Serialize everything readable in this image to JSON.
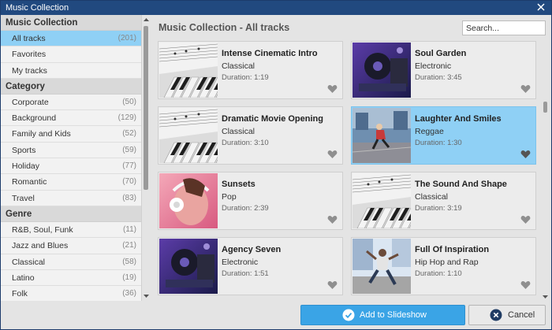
{
  "window": {
    "title": "Music Collection"
  },
  "sidebar": {
    "sections": [
      {
        "header": "Music Collection",
        "items": [
          {
            "label": "All tracks",
            "count": "(201)",
            "selected": true
          },
          {
            "label": "Favorites",
            "count": ""
          },
          {
            "label": "My tracks",
            "count": ""
          }
        ]
      },
      {
        "header": "Category",
        "items": [
          {
            "label": "Corporate",
            "count": "(50)"
          },
          {
            "label": "Background",
            "count": "(129)"
          },
          {
            "label": "Family and Kids",
            "count": "(52)"
          },
          {
            "label": "Sports",
            "count": "(59)"
          },
          {
            "label": "Holiday",
            "count": "(77)"
          },
          {
            "label": "Romantic",
            "count": "(70)"
          },
          {
            "label": "Travel",
            "count": "(83)"
          }
        ]
      },
      {
        "header": "Genre",
        "items": [
          {
            "label": "R&B, Soul, Funk",
            "count": "(11)"
          },
          {
            "label": "Jazz and Blues",
            "count": "(21)"
          },
          {
            "label": "Classical",
            "count": "(58)"
          },
          {
            "label": "Latino",
            "count": "(19)"
          },
          {
            "label": "Folk",
            "count": "(36)"
          }
        ]
      }
    ]
  },
  "main": {
    "title": "Music Collection - All tracks",
    "search_placeholder": "Search...",
    "tracks": [
      {
        "name": "Intense Cinematic Intro",
        "genre": "Classical",
        "duration": "Duration: 1:19",
        "thumb": "piano"
      },
      {
        "name": "Soul Garden",
        "genre": "Electronic",
        "duration": "Duration: 3:45",
        "thumb": "dj"
      },
      {
        "name": "Dramatic Movie Opening",
        "genre": "Classical",
        "duration": "Duration: 3:10",
        "thumb": "piano"
      },
      {
        "name": "Laughter And Smiles",
        "genre": "Reggae",
        "duration": "Duration: 1:30",
        "thumb": "runner",
        "selected": true
      },
      {
        "name": "Sunsets",
        "genre": "Pop",
        "duration": "Duration: 2:39",
        "thumb": "headphones"
      },
      {
        "name": "The Sound And Shape",
        "genre": "Classical",
        "duration": "Duration: 3:19",
        "thumb": "piano"
      },
      {
        "name": "Agency Seven",
        "genre": "Electronic",
        "duration": "Duration: 1:51",
        "thumb": "dj"
      },
      {
        "name": "Full Of Inspiration",
        "genre": "Hip Hop and Rap",
        "duration": "Duration: 1:10",
        "thumb": "dancer"
      }
    ]
  },
  "footer": {
    "add_label": "Add to Slideshow",
    "cancel_label": "Cancel"
  },
  "colors": {
    "titlebar": "#21497f",
    "selected": "#8fd0f5",
    "accent": "#3aa4e6"
  }
}
